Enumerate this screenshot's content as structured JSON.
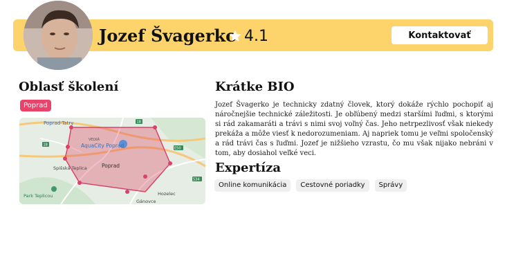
{
  "profile": {
    "name": "Jozef Švagerko",
    "rating": "4.1",
    "contact_label": "Kontaktovať"
  },
  "area": {
    "title": "Oblasť školení",
    "badge": "Poprad",
    "map_labels": {
      "poprad_tatry": "Poprad-Tatry",
      "velka": "VEĽKÁ",
      "aquacity": "AquaCity Poprad",
      "poprad": "Poprad",
      "spisska_teplica": "Spišská Teplica",
      "ganovce": "Gánovce",
      "hozelec": "Hozelec",
      "park_teplicou": "Park Teplicou",
      "road_18_a": "18",
      "road_18_b": "18",
      "road_534": "534",
      "road_e50": "E50"
    }
  },
  "bio": {
    "title": "Krátke BIO",
    "text": "Jozef Švagerko je technicky zdatný človek, ktorý dokáže rýchlo pochopiť aj náročnejšie technické záležitosti. Je obľúbený medzi staršími ľuďmi, s ktorými si rád zakamaráti a trávi s nimi svoj voľný čas. Jeho netrpezlivosť však niekedy prekáža a môže viesť k nedorozumeniam. Aj napriek tomu je veľmi spoločenský a rád trávi čas s ľuďmi. Jozef je nižšieho vzrastu, čo mu však nijako nebráni v tom, aby dosiahol veľké veci."
  },
  "expertise": {
    "title": "Expertíza",
    "skills": [
      "Online komunikácia",
      "Cestovné poriadky",
      "Správy"
    ]
  },
  "colors": {
    "header_bg": "#fdd46b",
    "badge_bg": "#e8436a",
    "polygon_stroke": "#d9436a"
  },
  "icons": {
    "rating": "star-icon"
  }
}
